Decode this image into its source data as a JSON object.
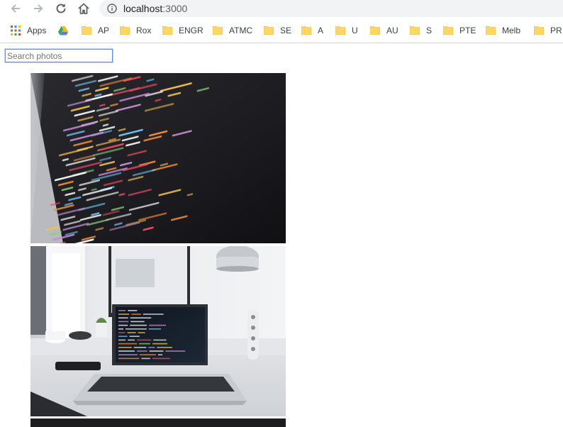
{
  "browser": {
    "url_host": "localhost",
    "url_port": ":3000",
    "icons": {
      "back": "arrow-left-icon",
      "forward": "arrow-right-icon",
      "reload": "reload-icon",
      "home": "home-icon",
      "info": "info-icon"
    }
  },
  "bookmarks": [
    {
      "label": "Apps",
      "icon": "apps-grid-icon"
    },
    {
      "label": "",
      "icon": "drive-icon"
    },
    {
      "label": "AP",
      "icon": "folder-icon"
    },
    {
      "label": "Rox",
      "icon": "folder-icon"
    },
    {
      "label": "ENGR",
      "icon": "folder-icon"
    },
    {
      "label": "ATMC",
      "icon": "folder-icon"
    },
    {
      "label": "SE",
      "icon": "folder-icon"
    },
    {
      "label": "A",
      "icon": "folder-icon"
    },
    {
      "label": "U",
      "icon": "folder-icon"
    },
    {
      "label": "AU",
      "icon": "folder-icon"
    },
    {
      "label": "S",
      "icon": "folder-icon"
    },
    {
      "label": "PTE",
      "icon": "folder-icon"
    },
    {
      "label": "Melb",
      "icon": "folder-icon"
    },
    {
      "label": "PR",
      "icon": "folder-icon"
    }
  ],
  "search": {
    "placeholder": "Search photos",
    "value": ""
  },
  "colors": {
    "folder": "#fdd663",
    "focus_border": "#4d90fe"
  }
}
